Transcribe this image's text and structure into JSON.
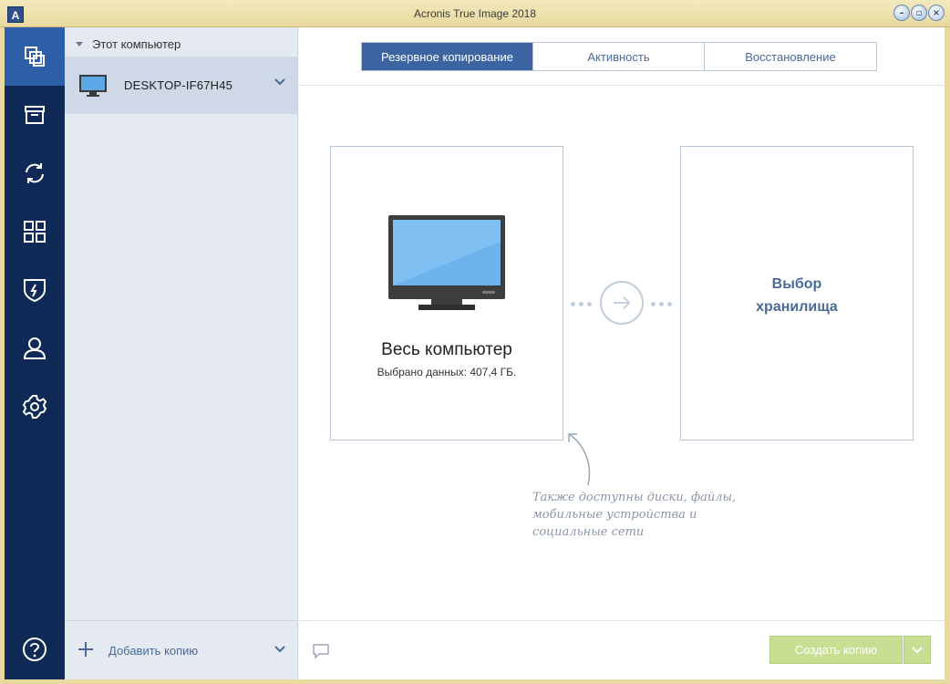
{
  "window": {
    "title": "Acronis True Image 2018",
    "logo_letter": "A",
    "controls": [
      "minimize",
      "restore",
      "close"
    ]
  },
  "rail": {
    "items": [
      {
        "icon": "copy-icon",
        "active": true
      },
      {
        "icon": "archive-icon",
        "active": false
      },
      {
        "icon": "sync-icon",
        "active": false
      },
      {
        "icon": "dashboard-icon",
        "active": false
      },
      {
        "icon": "shield-icon",
        "active": false
      },
      {
        "icon": "account-icon",
        "active": false
      },
      {
        "icon": "gear-icon",
        "active": false
      }
    ],
    "help_icon": "help-icon"
  },
  "sources": {
    "group_label": "Этот компьютер",
    "items": [
      {
        "name": "DESKTOP-IF67H45",
        "icon": "monitor-icon"
      }
    ],
    "add_label": "Добавить копию"
  },
  "tabs": [
    {
      "label": "Резервное копирование",
      "active": true
    },
    {
      "label": "Активность",
      "active": false
    },
    {
      "label": "Восстановление",
      "active": false
    }
  ],
  "source_card": {
    "title": "Весь компьютер",
    "subtitle": "Выбрано данных: 407,4 ГБ."
  },
  "dest_card": {
    "title_line1": "Выбор",
    "title_line2": "хранилища"
  },
  "hint": {
    "line1": "Также доступны диски, файлы,",
    "line2": "мобильные устройства и",
    "line3": "социальные сети"
  },
  "footer": {
    "create_label": "Создать копию"
  },
  "colors": {
    "rail_bg": "#0f2a56",
    "rail_active": "#2f5ea8",
    "tab_active": "#3c64a3",
    "accent_text": "#4a6a9a",
    "create_btn": "#c8df93"
  }
}
